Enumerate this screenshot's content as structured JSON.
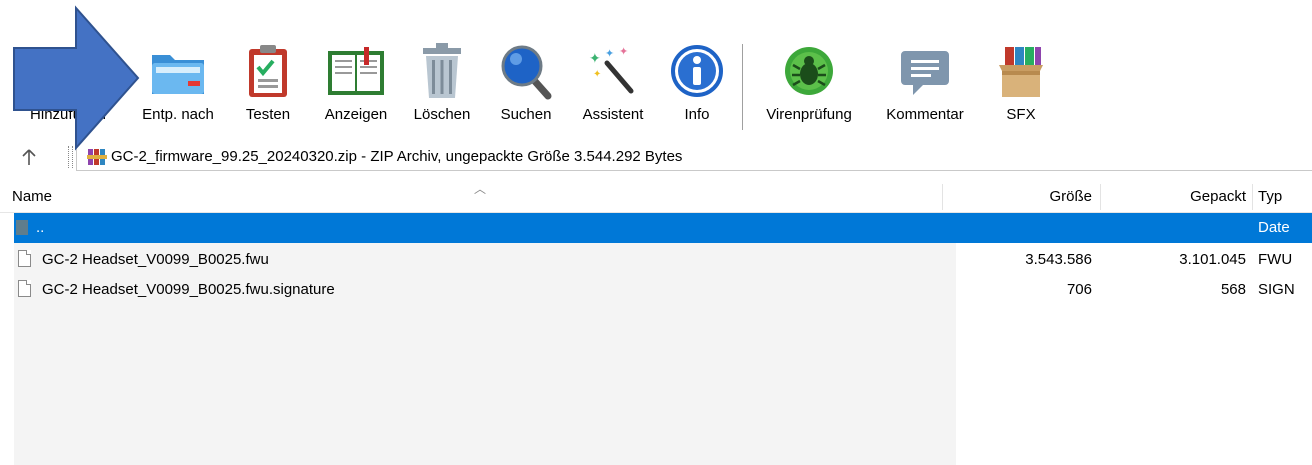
{
  "toolbar": {
    "buttons": [
      {
        "id": "add",
        "label": "Hinzufügen",
        "icon": "books-add-icon"
      },
      {
        "id": "extract",
        "label": "Entp. nach",
        "icon": "folder-extract-icon"
      },
      {
        "id": "test",
        "label": "Testen",
        "icon": "clipboard-check-icon"
      },
      {
        "id": "view",
        "label": "Anzeigen",
        "icon": "book-view-icon"
      },
      {
        "id": "delete",
        "label": "Löschen",
        "icon": "trash-icon"
      },
      {
        "id": "find",
        "label": "Suchen",
        "icon": "magnifier-icon"
      },
      {
        "id": "wizard",
        "label": "Assistent",
        "icon": "magic-wand-icon"
      },
      {
        "id": "info",
        "label": "Info",
        "icon": "info-icon"
      },
      {
        "id": "virus",
        "label": "Virenprüfung",
        "icon": "bug-scan-icon"
      },
      {
        "id": "comment",
        "label": "Kommentar",
        "icon": "comment-icon"
      },
      {
        "id": "sfx",
        "label": "SFX",
        "icon": "sfx-box-icon"
      }
    ]
  },
  "pathbar": {
    "up_icon": "up-arrow-icon",
    "archive_icon": "winrar-archive-icon",
    "path_text": "GC-2_firmware_99.25_20240320.zip - ZIP Archiv, ungepackte Größe 3.544.292 Bytes"
  },
  "columns": {
    "name": "Name",
    "size": "Größe",
    "packed": "Gepackt",
    "type": "Typ"
  },
  "rows": [
    {
      "name": "..",
      "size": "",
      "packed": "",
      "type": "Date",
      "selected": true
    },
    {
      "name": "GC-2 Headset_V0099_B0025.fwu",
      "size": "3.543.586",
      "packed": "3.101.045",
      "type": "FWU"
    },
    {
      "name": "GC-2 Headset_V0099_B0025.fwu.signature",
      "size": "706",
      "packed": "568",
      "type": "SIGN"
    }
  ],
  "colors": {
    "selection": "#0078d7",
    "arrow_fill": "#4472c4",
    "arrow_stroke": "#2f528f"
  }
}
